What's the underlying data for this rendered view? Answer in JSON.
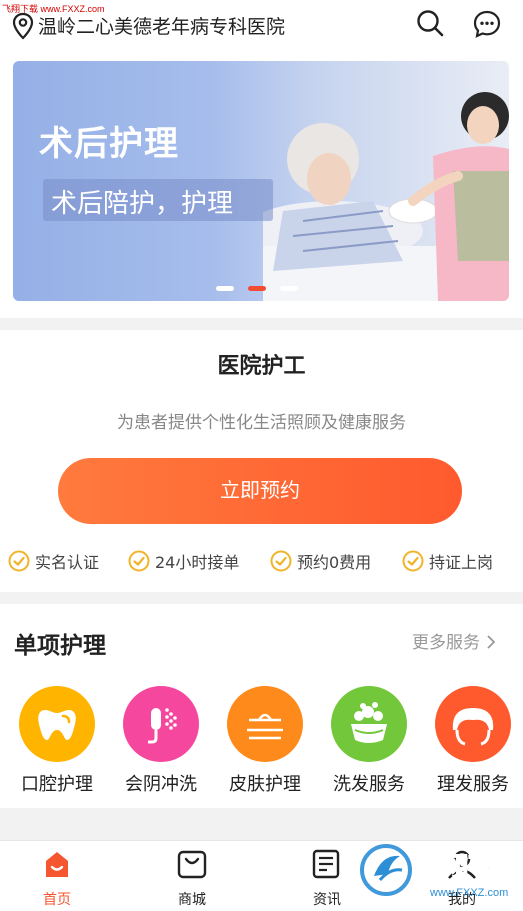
{
  "watermark_top": "飞翔下载 www.FXXZ.com",
  "header": {
    "hospital_name": "温岭二心美德老年病专科医院",
    "location_icon": "location-pin-icon",
    "search_icon": "search-icon",
    "message_icon": "chat-bubble-icon"
  },
  "banner": {
    "title": "术后护理",
    "subtitle": "术后陪护，护理",
    "slide_count": 3,
    "active_slide": 2
  },
  "service": {
    "title": "医院护工",
    "subtitle": "为患者提供个性化生活照顾及健康服务",
    "book_button": "立即预约",
    "features": [
      "实名认证",
      "24小时接单",
      "预约0费用",
      "持证上岗"
    ]
  },
  "care": {
    "title": "单项护理",
    "more": "更多服务",
    "items": [
      {
        "label": "口腔护理",
        "icon": "tooth-icon",
        "color": "#ffb400"
      },
      {
        "label": "会阴冲洗",
        "icon": "shower-icon",
        "color": "#f5479e"
      },
      {
        "label": "皮肤护理",
        "icon": "skin-icon",
        "color": "#ff8a1c"
      },
      {
        "label": "洗发服务",
        "icon": "hair-wash-icon",
        "color": "#72c83a"
      },
      {
        "label": "理发服务",
        "icon": "haircut-icon",
        "color": "#ff5a2e"
      }
    ]
  },
  "tabs": [
    {
      "label": "首页",
      "icon": "home-icon",
      "active": true
    },
    {
      "label": "商城",
      "icon": "shopping-bag-icon",
      "active": false
    },
    {
      "label": "资讯",
      "icon": "news-icon",
      "active": false
    },
    {
      "label": "我的",
      "icon": "profile-icon",
      "active": false
    }
  ],
  "watermark_logo": {
    "brand": "飞翔下载",
    "url": "www.FXXZ.com"
  },
  "colors": {
    "accent": "#f5552f",
    "check": "#f0b429"
  }
}
